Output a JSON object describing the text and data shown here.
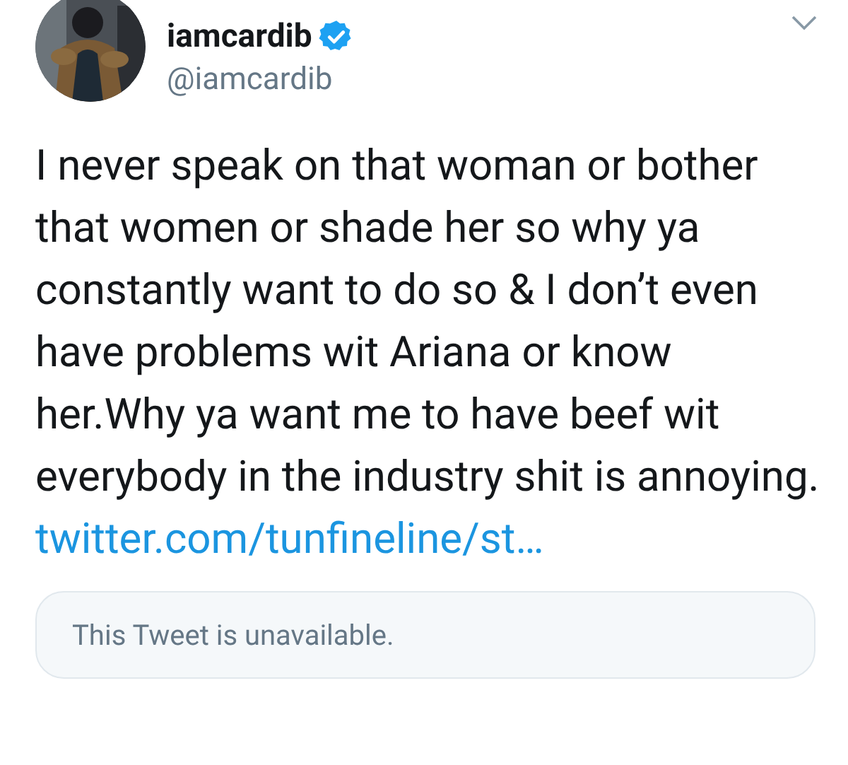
{
  "author": {
    "name": "iamcardib",
    "verified": true,
    "handle": "@iamcardib"
  },
  "tweet": {
    "text": "I never speak on that woman or bother that women or shade her so why ya constantly want to do so & I don’t even have problems wit Ariana or know her.Why ya want me to have beef wit everybody in the industry shit is annoying.",
    "link": "twitter.com/tunfineline/st…"
  },
  "quoted": {
    "text": "This Tweet is unavailable."
  }
}
